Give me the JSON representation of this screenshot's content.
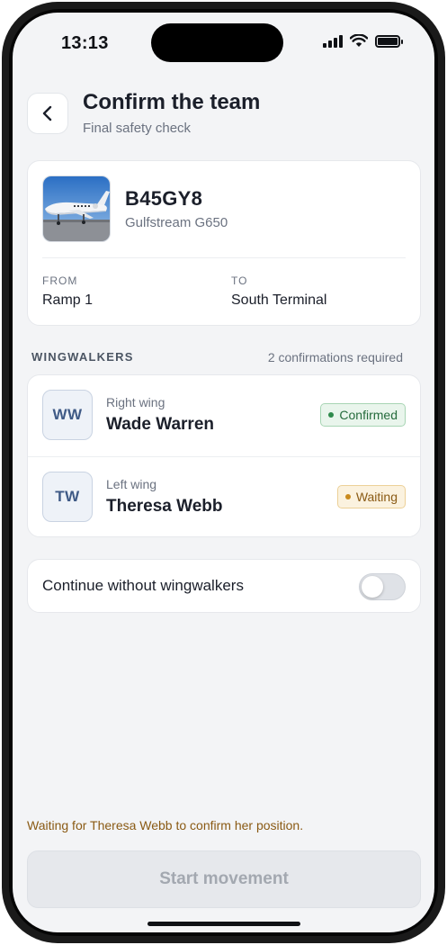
{
  "status_bar": {
    "time": "13:13",
    "icons": [
      "cellular-signal-icon",
      "wifi-icon",
      "battery-icon"
    ],
    "battery_level": 1.0
  },
  "header": {
    "back_icon": "chevron-left-icon",
    "title": "Confirm the team",
    "subtitle": "Final safety check"
  },
  "aircraft": {
    "registration": "B45GY8",
    "model": "Gulfstream G650",
    "from_label": "FROM",
    "from_value": "Ramp 1",
    "to_label": "TO",
    "to_value": "South Terminal"
  },
  "wingwalkers": {
    "section_title": "WINGWALKERS",
    "requirement": "2 confirmations required",
    "items": [
      {
        "initials": "WW",
        "role": "Right wing",
        "name": "Wade Warren",
        "status": "Confirmed",
        "status_color": "#2f8a4c"
      },
      {
        "initials": "TW",
        "role": "Left wing",
        "name": "Theresa Webb",
        "status": "Waiting",
        "status_color": "#c98a1e"
      }
    ]
  },
  "bypass": {
    "label": "Continue without wingwalkers",
    "enabled": false
  },
  "footer": {
    "note": "Waiting for Theresa Webb to confirm her position.",
    "start_label": "Start movement",
    "start_enabled": false
  },
  "colors": {
    "background": "#f3f4f6",
    "confirmed": "#2f8a4c",
    "waiting": "#8a5a14",
    "avatar_text": "#3f5a86"
  }
}
